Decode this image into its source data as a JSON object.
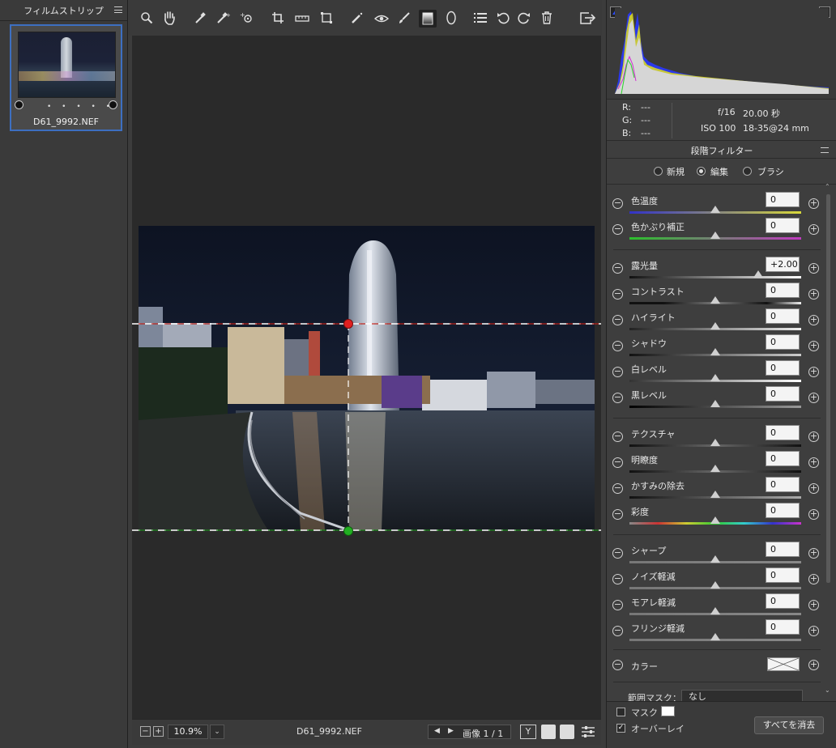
{
  "filmstrip": {
    "title": "フィルムストリップ",
    "thumbnail": {
      "filename": "D61_9992.NEF",
      "rating_dots": "• • • • •"
    }
  },
  "toolbar": {
    "tools": [
      "zoom-icon",
      "hand-icon",
      "white-balance-icon",
      "color-sampler-icon",
      "target-adjust-icon",
      "crop-icon",
      "straighten-icon",
      "transform-icon",
      "spot-removal-icon",
      "red-eye-icon",
      "adjustment-brush-icon",
      "graduated-filter-icon",
      "radial-filter-icon",
      "presets-list-icon",
      "rotate-left-icon",
      "rotate-right-icon",
      "trash-icon",
      "open-preferences-icon"
    ]
  },
  "bottombar": {
    "zoom_value": "10.9%",
    "filename": "D61_9992.NEF",
    "image_counter": "画像 1 / 1",
    "compare_label": "Y"
  },
  "info": {
    "r_label": "R:",
    "r_value": "---",
    "g_label": "G:",
    "g_value": "---",
    "b_label": "B:",
    "b_value": "---",
    "aperture": "f/16",
    "shutter": "20.00 秒",
    "iso": "ISO 100",
    "lens": "18-35@24 mm"
  },
  "panel": {
    "title": "段階フィルター",
    "modes": [
      {
        "label": "新規",
        "selected": false
      },
      {
        "label": "編集",
        "selected": true
      },
      {
        "label": "ブラシ",
        "selected": false
      }
    ],
    "sliders": [
      {
        "label": "色温度",
        "value": "0",
        "position": 0.5
      },
      {
        "label": "色かぶり補正",
        "value": "0",
        "position": 0.5
      },
      {
        "label": "露光量",
        "value": "+2.00",
        "position": 0.75
      },
      {
        "label": "コントラスト",
        "value": "0",
        "position": 0.5
      },
      {
        "label": "ハイライト",
        "value": "0",
        "position": 0.5
      },
      {
        "label": "シャドウ",
        "value": "0",
        "position": 0.5
      },
      {
        "label": "白レベル",
        "value": "0",
        "position": 0.5
      },
      {
        "label": "黒レベル",
        "value": "0",
        "position": 0.5
      },
      {
        "label": "テクスチャ",
        "value": "0",
        "position": 0.5
      },
      {
        "label": "明瞭度",
        "value": "0",
        "position": 0.5
      },
      {
        "label": "かすみの除去",
        "value": "0",
        "position": 0.5
      },
      {
        "label": "彩度",
        "value": "0",
        "position": 0.5
      },
      {
        "label": "シャープ",
        "value": "0",
        "position": 0.5
      },
      {
        "label": "ノイズ軽減",
        "value": "0",
        "position": 0.5
      },
      {
        "label": "モアレ軽減",
        "value": "0",
        "position": 0.5
      },
      {
        "label": "フリンジ軽減",
        "value": "0",
        "position": 0.5
      }
    ],
    "color_label": "カラー",
    "range_mask_label": "範囲マスク：",
    "range_mask_value": "なし"
  },
  "bottom": {
    "mask_label": "マスク",
    "mask_checked": false,
    "overlay_label": "オーバーレイ",
    "overlay_checked": true,
    "clear_all_label": "すべてを消去"
  },
  "colors": {
    "accent": "#3d6fc1",
    "filter_top_pin": "#e02020",
    "filter_bottom_pin": "#22b022"
  }
}
